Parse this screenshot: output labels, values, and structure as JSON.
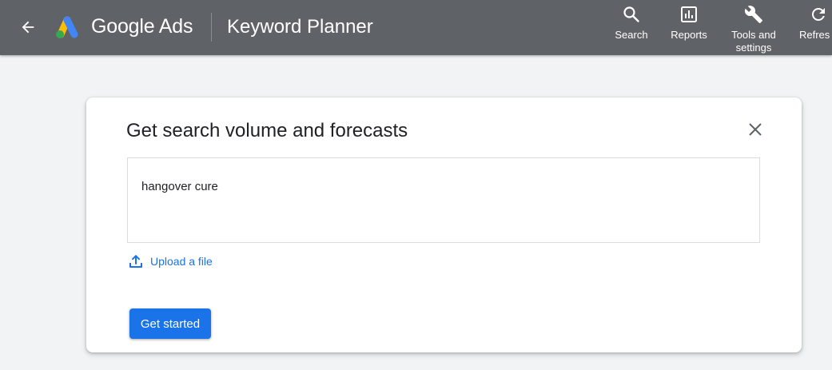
{
  "header": {
    "brand": "Google Ads",
    "page_title": "Keyword Planner",
    "tools": [
      {
        "label": "Search",
        "icon": "search-icon"
      },
      {
        "label": "Reports",
        "icon": "reports-icon"
      },
      {
        "label": "Tools and\nsettings",
        "icon": "wrench-icon"
      },
      {
        "label": "Refres",
        "icon": "refresh-icon"
      }
    ]
  },
  "dialog": {
    "title": "Get search volume and forecasts",
    "keywords_value": "hangover cure",
    "upload_label": "Upload a file",
    "primary_button": "Get started"
  },
  "colors": {
    "header_bg": "#5f6368",
    "page_bg": "#f1f3f4",
    "accent": "#1a73e8",
    "logo_blue": "#4285f4",
    "logo_yellow": "#fbbc04",
    "logo_green": "#34a853"
  }
}
